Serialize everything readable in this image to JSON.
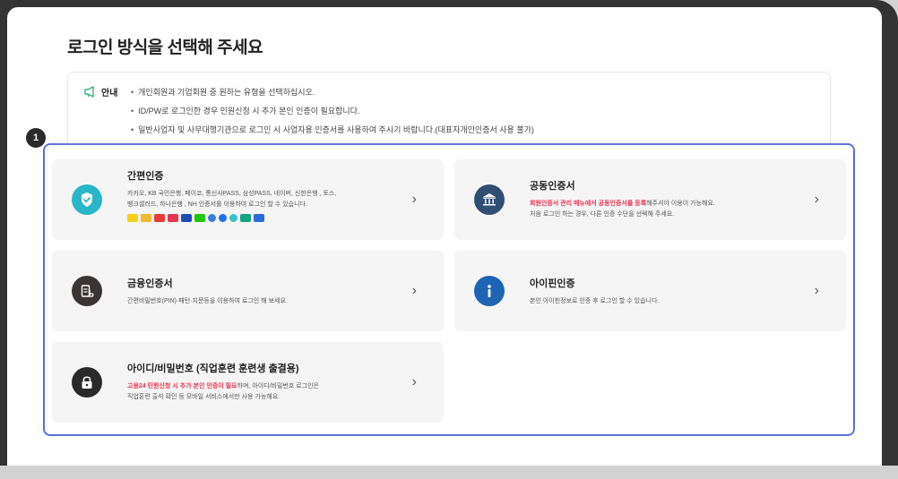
{
  "page": {
    "title": "로그인 방식을 선택해 주세요"
  },
  "notice": {
    "label": "안내",
    "items": [
      "개인회원과 기업회원 중 원하는 유형을 선택하십시오.",
      "ID/PW로 로그인한 경우 민원신청 시 추가 본인 인증이 필요합니다.",
      "일반사업자 및 사무대행기관으로 로그인 시 사업자용 인증서를 사용하여 주시기 바랍니다.(대표자개인인증서 사용 불가)"
    ]
  },
  "marker": "1",
  "cards": {
    "simple": {
      "title": "간편인증",
      "desc1": "카카오, KB 국민은행, 페이코, 통신사PASS, 삼성PASS, 네이버, 신한은행 , 토스,",
      "desc2": "뱅크샐러드, 하나은행 , NH 인증서를 이용하여 로그인 할 수 있습니다.",
      "icon": "shield-check-icon",
      "icon_color": "#29b6c8",
      "chevron": "›"
    },
    "joint": {
      "title": "공동인증서",
      "desc_red": "회원인증서 관리 메뉴에서 공동인증서를 등록",
      "desc1_rest": "해주셔야 이용이 가능해요.",
      "desc2": "처음 로그인 하는 경우, 다른 인증 수단을 선택해 주세요.",
      "icon": "bank-building-icon",
      "icon_color": "#2f4f73",
      "chevron": "›"
    },
    "finance": {
      "title": "금융인증서",
      "desc1": "간편비밀번호(PIN)·패턴·지문등을 이용하여 로그인 해 보세요.",
      "icon": "finance-certificate-icon",
      "icon_color": "#3a3434",
      "chevron": "›"
    },
    "ipin": {
      "title": "아이핀인증",
      "desc1": "본인 아이핀정보로 인증 후 로그인 할 수 있습니다.",
      "icon": "info-icon",
      "icon_color": "#1e64b4",
      "chevron": "›"
    },
    "idpw": {
      "title": "아이디/비밀번호 (직업훈련 훈련생 출결용)",
      "desc_red": "고용24 민원신청 시 추가 본인 인증이 필요",
      "desc1_rest": "하며, 아이디/비밀번호 로그인은",
      "desc2": "직업훈련 출석 확인 등 모바일 서비스에서만 사용 가능해요.",
      "icon": "lock-icon",
      "icon_color": "#2a2a2a",
      "chevron": "›"
    }
  },
  "colors": {
    "accent_border": "#5b72d6",
    "highlight_red": "#e8344e"
  }
}
